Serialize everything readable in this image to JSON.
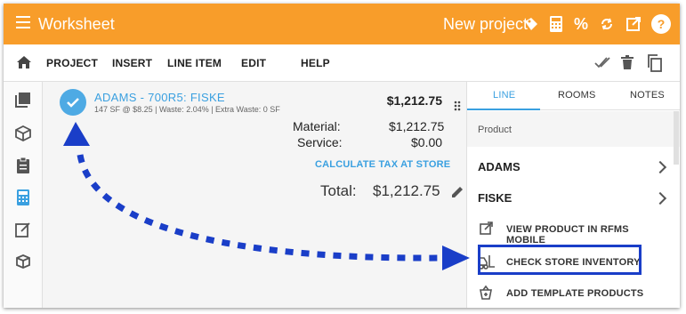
{
  "appbar": {
    "title": "Worksheet",
    "project": "New project",
    "icons": [
      "menu-icon",
      "tag-icon",
      "calculator-icon",
      "percent-icon",
      "sync-icon",
      "open-external-icon",
      "help-icon"
    ],
    "color": "#f89d2a"
  },
  "menubar": {
    "items": [
      "PROJECT",
      "INSERT",
      "LINE ITEM",
      "EDIT",
      "HELP"
    ],
    "icons": [
      "home-icon",
      "done-all-icon",
      "delete-icon",
      "copy-icon"
    ]
  },
  "rail": {
    "icons": [
      "layers-icon",
      "package-icon",
      "clipboard-icon",
      "calculator-icon",
      "edit-note-icon",
      "box-export-icon"
    ]
  },
  "line": {
    "title": "ADAMS - 700R5: FISKE",
    "subtitle": "147 SF @ $8.25 | Waste: 2.04% | Extra Waste: 0 SF",
    "total": "$1,212.75",
    "material_label": "Material:",
    "material_value": "$1,212.75",
    "service_label": "Service:",
    "service_value": "$0.00",
    "tax_label": "CALCULATE TAX AT STORE",
    "grand_label": "Total:",
    "grand_value": "$1,212.75"
  },
  "panel": {
    "tabs": [
      "LINE",
      "ROOMS",
      "NOTES"
    ],
    "active_tab": "LINE",
    "section": "Product",
    "products": [
      "ADAMS",
      "FISKE"
    ],
    "actions": [
      "VIEW PRODUCT IN RFMS MOBILE",
      "CHECK STORE INVENTORY",
      "ADD TEMPLATE PRODUCTS"
    ],
    "highlighted_action": "CHECK STORE INVENTORY",
    "accent": "#3aa0e0",
    "highlight_color": "#1a3ec8"
  }
}
